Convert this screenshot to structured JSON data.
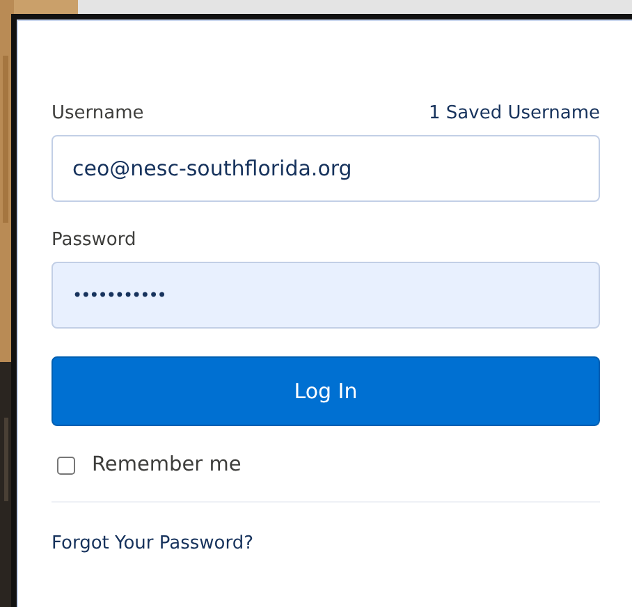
{
  "username": {
    "label": "Username",
    "saved_link": "1 Saved Username",
    "value": "ceo@nesc-southflorida.org"
  },
  "password": {
    "label": "Password",
    "value": "•••••••••••",
    "autofilled": true
  },
  "login_button": "Log In",
  "remember_me": {
    "label": "Remember me",
    "checked": false
  },
  "forgot_link": "Forgot Your Password?"
}
